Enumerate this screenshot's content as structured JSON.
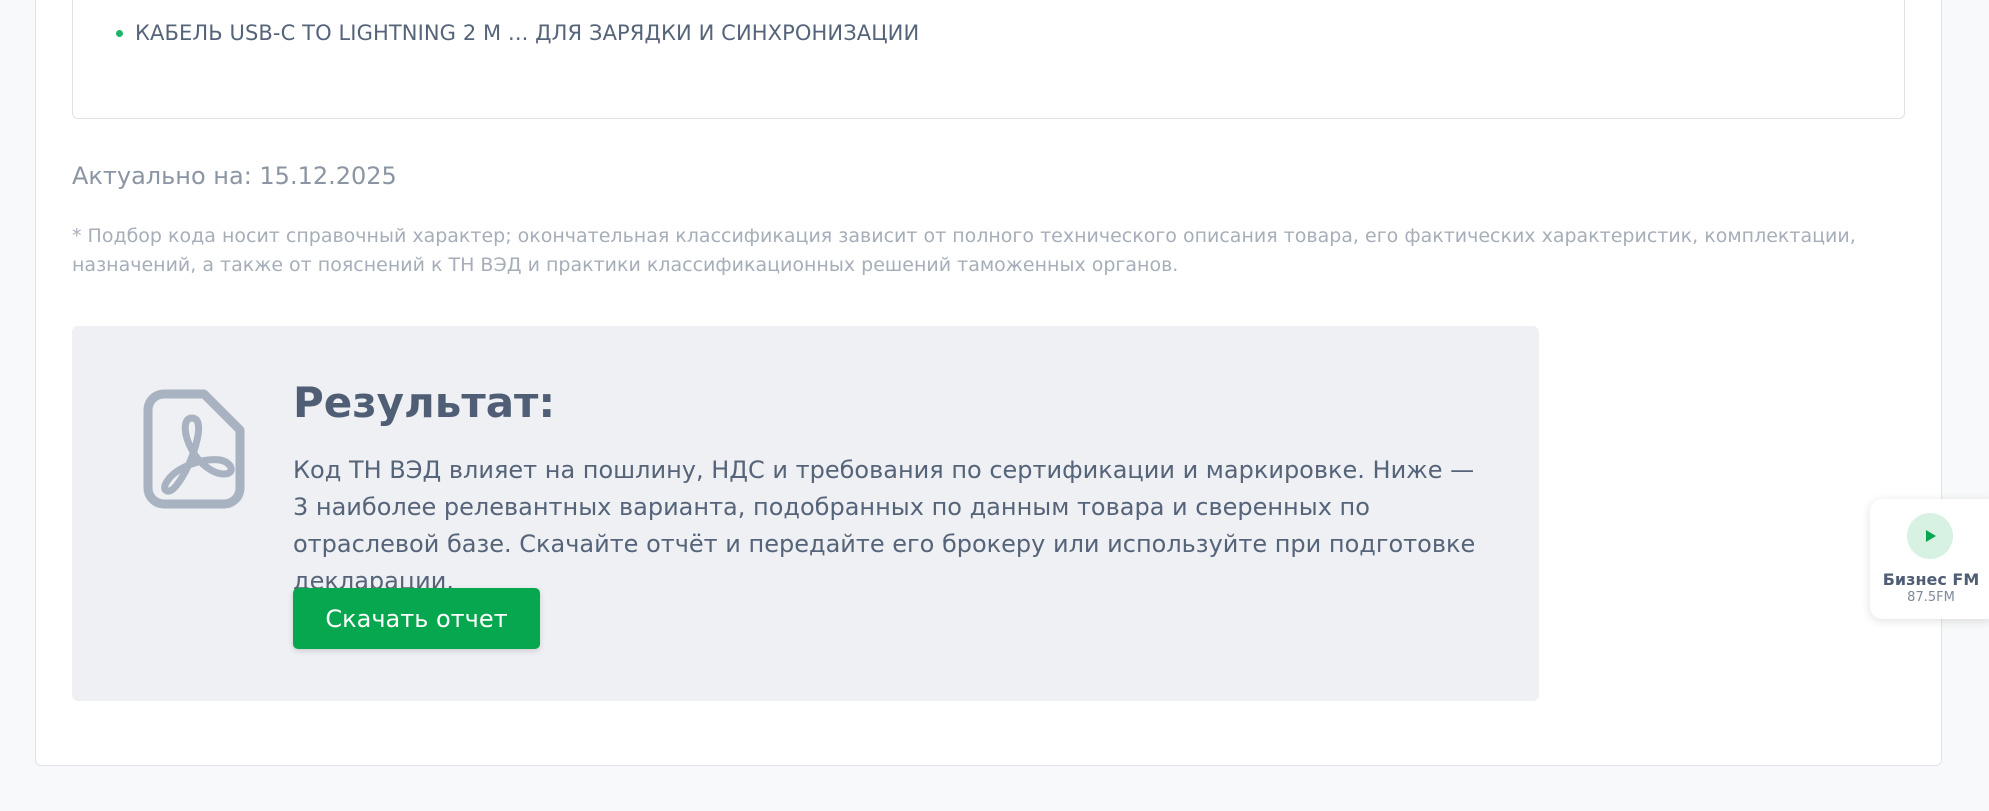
{
  "product_list": {
    "items": [
      "КАБЕЛЬ USB-C TO LIGHTNING 2 M ... ДЛЯ ЗАРЯДКИ И СИНХРОНИЗАЦИИ"
    ]
  },
  "actual_date": "Актуально на: 15.12.2025",
  "disclaimer": "* Подбор кода носит справочный характер; окончательная классификация зависит от полного технического описания товара, его фактических характеристик, комплектации, назначений, а также от пояснений к ТН ВЭД и практики классификационных решений таможенных органов.",
  "result": {
    "icon": "pdf-icon",
    "title": "Результат:",
    "text": "Код ТН ВЭД влияет на пошлину, НДС и требования по сертификации и маркировке. Ниже — 3 наиболее релевантных варианта, подобранных по данным товара и сверенных по отраслевой базе. Скачайте отчёт и передайте его брокеру или используйте при подготовке декларации.",
    "download_label": "Скачать отчет"
  },
  "radio": {
    "icon": "play-icon",
    "name": "Бизнес FM",
    "frequency": "87.5FM"
  },
  "colors": {
    "accent": "#07a74f",
    "bullet": "#1fb46b",
    "panel_bg": "#eef0f3"
  }
}
